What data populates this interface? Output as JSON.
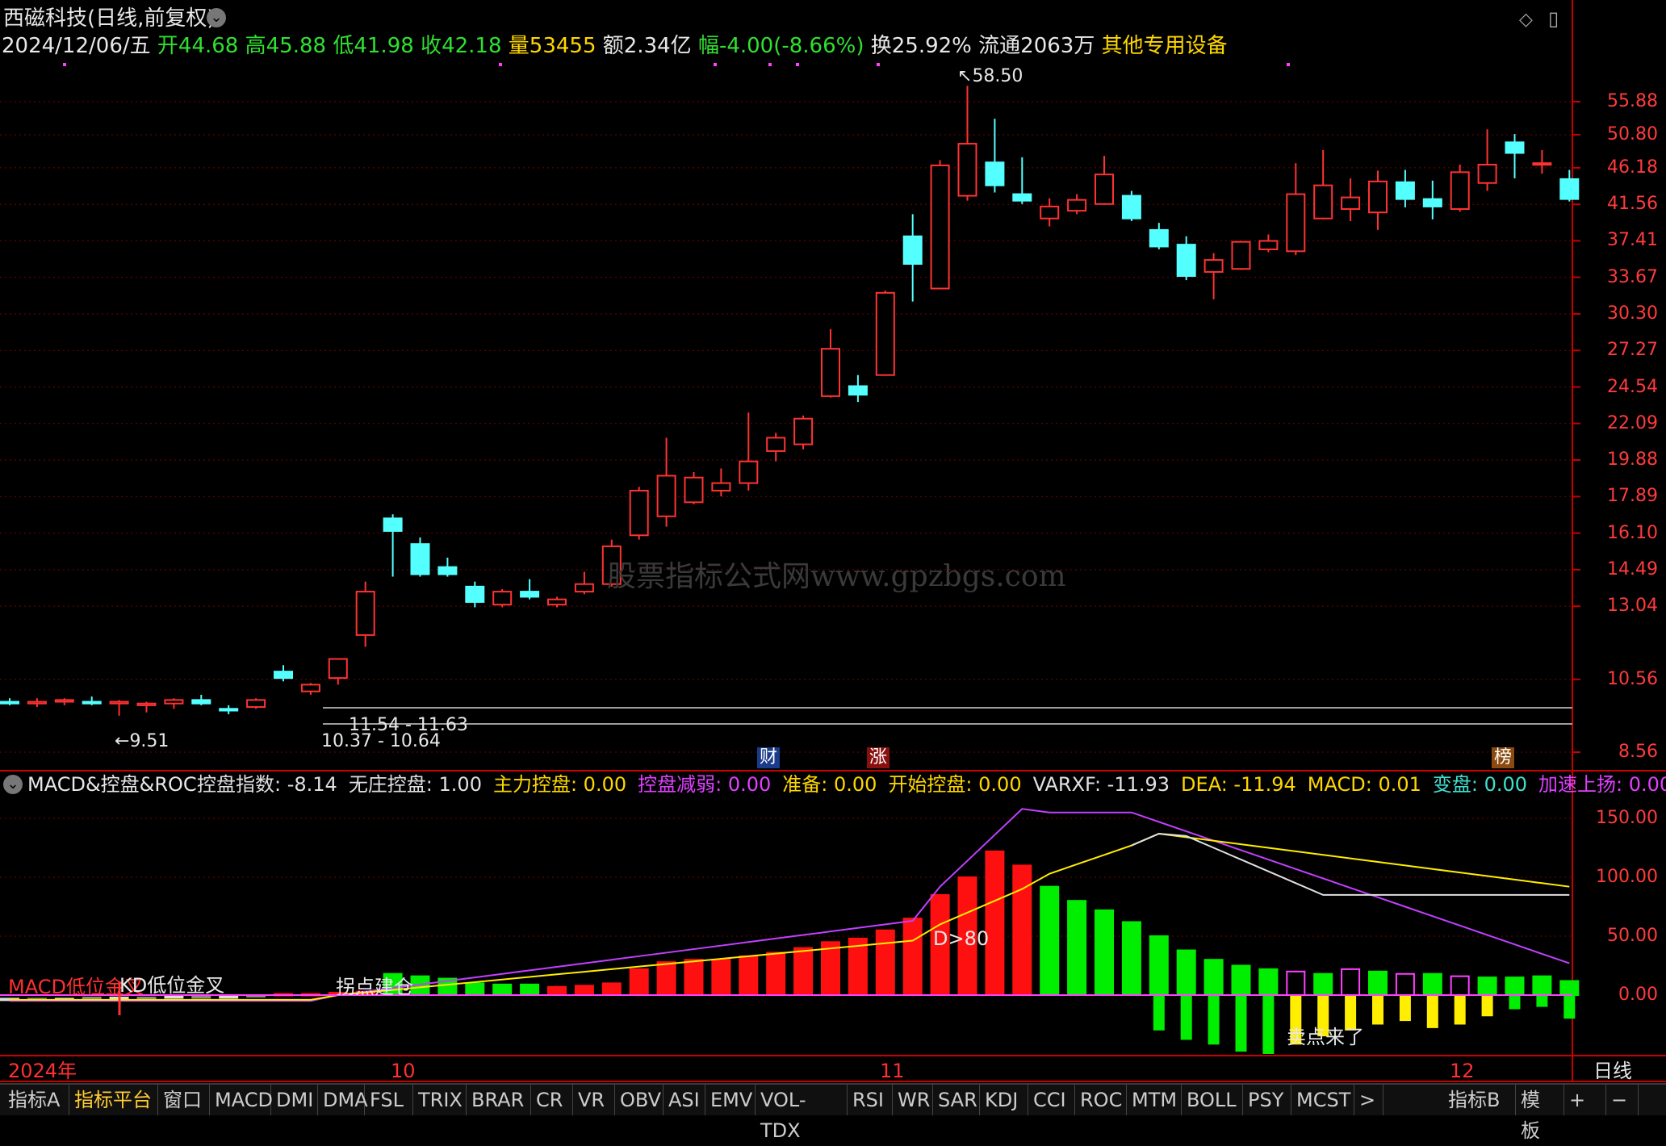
{
  "header": {
    "stock_title": "西磁科技(日线,前复权)",
    "date": "2024/12/06/五",
    "open_label": "开",
    "open": "44.68",
    "high_label": "高",
    "high": "45.88",
    "low_label": "低",
    "low": "41.98",
    "close_label": "收",
    "close": "42.18",
    "vol_label": "量",
    "vol": "53455",
    "amount": "额2.34亿",
    "change": "幅-4.00(-8.66%)",
    "turnover": "换25.92%",
    "float_shares": "流通2063万",
    "industry": "其他专用设备"
  },
  "price_axis": [
    "55.88",
    "50.80",
    "46.18",
    "41.56",
    "37.41",
    "33.67",
    "30.30",
    "27.27",
    "24.54",
    "22.09",
    "19.88",
    "17.89",
    "16.10",
    "14.49",
    "13.04",
    "10.56",
    "8.56"
  ],
  "annotations": {
    "high_marker": "58.50",
    "low_marker": "9.51",
    "range1": "11.54 - 11.63",
    "range2": "10.37 - 10.64",
    "watermark": "股票指标公式网www.gpzbgs.com",
    "tag_cai": "财",
    "tag_zhang": "涨",
    "tag_bang": "榜"
  },
  "indicator": {
    "name": "MACD&控盘&ROC",
    "items": [
      {
        "label": "控盘指数: -8.14",
        "color": "#e0e0e0"
      },
      {
        "label": "无庄控盘: 1.00",
        "color": "#e0e0e0"
      },
      {
        "label": "主力控盘: 0.00",
        "color": "#ffd700"
      },
      {
        "label": "控盘减弱: 0.00",
        "color": "#e040ff"
      },
      {
        "label": "准备: 0.00",
        "color": "#ffd700"
      },
      {
        "label": "开始控盘: 0.00",
        "color": "#ffd700"
      },
      {
        "label": "VARXF: -11.93",
        "color": "#e0e0e0"
      },
      {
        "label": "DEA: -11.94",
        "color": "#ffd700"
      },
      {
        "label": "MACD: 0.01",
        "color": "#ffd700"
      },
      {
        "label": "变盘: 0.00",
        "color": "#40e0d0"
      },
      {
        "label": "加速上扬: 0.00",
        "color": "#e040ff"
      }
    ],
    "axis": [
      "150.00",
      "100.00",
      "50.00",
      "0.00"
    ],
    "notes": {
      "macd_low": "MACD低位金叉",
      "kd_low": "KD低位金叉",
      "turn": "拐点建仓",
      "d80": "D>80",
      "sell": "卖点来了"
    }
  },
  "time_axis": {
    "year": "2024年",
    "m10": "10",
    "m11": "11",
    "m12": "12",
    "period": "日线"
  },
  "tabs": [
    "指标A",
    "指标平台",
    "窗口",
    "MACD",
    "DMI",
    "DMA",
    "FSL",
    "TRIX",
    "BRAR",
    "CR",
    "VR",
    "OBV",
    "ASI",
    "EMV",
    "VOL-TDX",
    "RSI",
    "WR",
    "SAR",
    "KDJ",
    "CCI",
    "ROC",
    "MTM",
    "BOLL",
    "PSY",
    "MCST",
    ">",
    "指标B",
    "模 板",
    "+",
    "−"
  ],
  "colors": {
    "up": "#ff3232",
    "down": "#54ffff",
    "grid": "#7a0000",
    "axis": "#ff3b3b"
  },
  "candles": [
    {
      "o": 9.9,
      "h": 10.0,
      "l": 9.8,
      "c": 9.85
    },
    {
      "o": 9.85,
      "h": 10.0,
      "l": 9.75,
      "c": 9.9
    },
    {
      "o": 9.9,
      "h": 10.0,
      "l": 9.8,
      "c": 9.95
    },
    {
      "o": 9.9,
      "h": 10.05,
      "l": 9.8,
      "c": 9.85
    },
    {
      "o": 9.85,
      "h": 9.95,
      "l": 9.51,
      "c": 9.9
    },
    {
      "o": 9.8,
      "h": 9.9,
      "l": 9.6,
      "c": 9.85
    },
    {
      "o": 9.85,
      "h": 10.0,
      "l": 9.7,
      "c": 9.95
    },
    {
      "o": 9.95,
      "h": 10.1,
      "l": 9.8,
      "c": 9.85
    },
    {
      "o": 9.7,
      "h": 9.8,
      "l": 9.55,
      "c": 9.65
    },
    {
      "o": 9.75,
      "h": 10.0,
      "l": 9.7,
      "c": 9.95
    },
    {
      "o": 10.8,
      "h": 11.0,
      "l": 10.5,
      "c": 10.6
    },
    {
      "o": 10.2,
      "h": 10.45,
      "l": 10.1,
      "c": 10.4
    },
    {
      "o": 10.6,
      "h": 11.0,
      "l": 10.4,
      "c": 11.2
    },
    {
      "o": 12.0,
      "h": 14.0,
      "l": 11.6,
      "c": 13.6
    },
    {
      "o": 16.8,
      "h": 17.0,
      "l": 14.2,
      "c": 16.2
    },
    {
      "o": 15.6,
      "h": 15.9,
      "l": 14.2,
      "c": 14.3
    },
    {
      "o": 14.6,
      "h": 15.0,
      "l": 14.2,
      "c": 14.3
    },
    {
      "o": 13.8,
      "h": 14.0,
      "l": 13.0,
      "c": 13.2
    },
    {
      "o": 13.1,
      "h": 13.7,
      "l": 13.0,
      "c": 13.6
    },
    {
      "o": 13.6,
      "h": 14.1,
      "l": 13.3,
      "c": 13.4
    },
    {
      "o": 13.1,
      "h": 13.4,
      "l": 13.0,
      "c": 13.3
    },
    {
      "o": 13.6,
      "h": 14.4,
      "l": 13.5,
      "c": 13.9
    },
    {
      "o": 13.9,
      "h": 15.8,
      "l": 13.8,
      "c": 15.5
    },
    {
      "o": 16.0,
      "h": 18.4,
      "l": 15.8,
      "c": 18.2
    },
    {
      "o": 16.9,
      "h": 21.2,
      "l": 16.4,
      "c": 19.0
    },
    {
      "o": 17.6,
      "h": 19.2,
      "l": 17.5,
      "c": 18.9
    },
    {
      "o": 18.2,
      "h": 19.4,
      "l": 17.9,
      "c": 18.6
    },
    {
      "o": 18.6,
      "h": 22.8,
      "l": 18.2,
      "c": 19.8
    },
    {
      "o": 20.4,
      "h": 21.5,
      "l": 19.8,
      "c": 21.2
    },
    {
      "o": 20.8,
      "h": 22.6,
      "l": 20.5,
      "c": 22.4
    },
    {
      "o": 23.9,
      "h": 29.0,
      "l": 23.8,
      "c": 27.4
    },
    {
      "o": 24.6,
      "h": 25.4,
      "l": 23.5,
      "c": 24.0
    },
    {
      "o": 25.4,
      "h": 32.4,
      "l": 25.4,
      "c": 32.2
    },
    {
      "o": 37.9,
      "h": 40.4,
      "l": 31.4,
      "c": 35.0
    },
    {
      "o": 32.6,
      "h": 47.2,
      "l": 32.6,
      "c": 46.5
    },
    {
      "o": 42.6,
      "h": 58.5,
      "l": 42.0,
      "c": 49.5
    },
    {
      "o": 46.9,
      "h": 53.2,
      "l": 43.0,
      "c": 43.9
    },
    {
      "o": 42.8,
      "h": 47.6,
      "l": 41.6,
      "c": 42.0
    },
    {
      "o": 39.9,
      "h": 42.3,
      "l": 39.0,
      "c": 41.3
    },
    {
      "o": 40.8,
      "h": 42.8,
      "l": 40.4,
      "c": 42.1
    },
    {
      "o": 41.6,
      "h": 47.8,
      "l": 41.5,
      "c": 45.3
    },
    {
      "o": 42.6,
      "h": 43.2,
      "l": 39.6,
      "c": 39.9
    },
    {
      "o": 38.6,
      "h": 39.4,
      "l": 36.5,
      "c": 36.8
    },
    {
      "o": 37.0,
      "h": 37.9,
      "l": 33.4,
      "c": 33.8
    },
    {
      "o": 34.2,
      "h": 36.1,
      "l": 31.6,
      "c": 35.4
    },
    {
      "o": 34.5,
      "h": 37.4,
      "l": 34.4,
      "c": 37.3
    },
    {
      "o": 36.5,
      "h": 38.1,
      "l": 36.2,
      "c": 37.4
    },
    {
      "o": 36.3,
      "h": 46.8,
      "l": 35.9,
      "c": 42.8
    },
    {
      "o": 39.9,
      "h": 48.6,
      "l": 39.8,
      "c": 43.9
    },
    {
      "o": 41.0,
      "h": 44.8,
      "l": 39.6,
      "c": 42.4
    },
    {
      "o": 40.6,
      "h": 45.8,
      "l": 38.6,
      "c": 44.4
    },
    {
      "o": 44.3,
      "h": 45.9,
      "l": 41.2,
      "c": 42.2
    },
    {
      "o": 42.2,
      "h": 44.5,
      "l": 39.8,
      "c": 41.3
    },
    {
      "o": 41.0,
      "h": 46.6,
      "l": 40.7,
      "c": 45.6
    },
    {
      "o": 44.2,
      "h": 51.6,
      "l": 43.2,
      "c": 46.6
    },
    {
      "o": 49.7,
      "h": 50.9,
      "l": 44.8,
      "c": 48.2
    },
    {
      "o": 46.8,
      "h": 48.6,
      "l": 45.4,
      "c": 46.8
    },
    {
      "o": 44.7,
      "h": 45.9,
      "l": 41.9,
      "c": 42.2
    }
  ],
  "macd_bars": [
    -3,
    -3,
    -3,
    -2,
    -2,
    -2,
    -1,
    -1,
    -1,
    0,
    1,
    1,
    2,
    3,
    18,
    16,
    14,
    10,
    9,
    9,
    7,
    8,
    10,
    22,
    28,
    30,
    30,
    33,
    36,
    40,
    45,
    48,
    55,
    65,
    85,
    100,
    122,
    110,
    92,
    80,
    72,
    62,
    50,
    38,
    30,
    25,
    22,
    20,
    18,
    22,
    20,
    18,
    18,
    16,
    15,
    15,
    16,
    12
  ],
  "macd_neg_bars": [
    0,
    0,
    0,
    0,
    0,
    0,
    0,
    0,
    0,
    0,
    0,
    0,
    0,
    0,
    0,
    0,
    0,
    0,
    0,
    0,
    0,
    0,
    0,
    0,
    0,
    0,
    0,
    0,
    0,
    0,
    0,
    0,
    0,
    0,
    0,
    0,
    0,
    0,
    0,
    0,
    0,
    0,
    -30,
    -38,
    -42,
    -48,
    -50,
    -42,
    -35,
    -30,
    -25,
    -22,
    -28,
    -25,
    -18,
    -12,
    -10,
    -20
  ]
}
